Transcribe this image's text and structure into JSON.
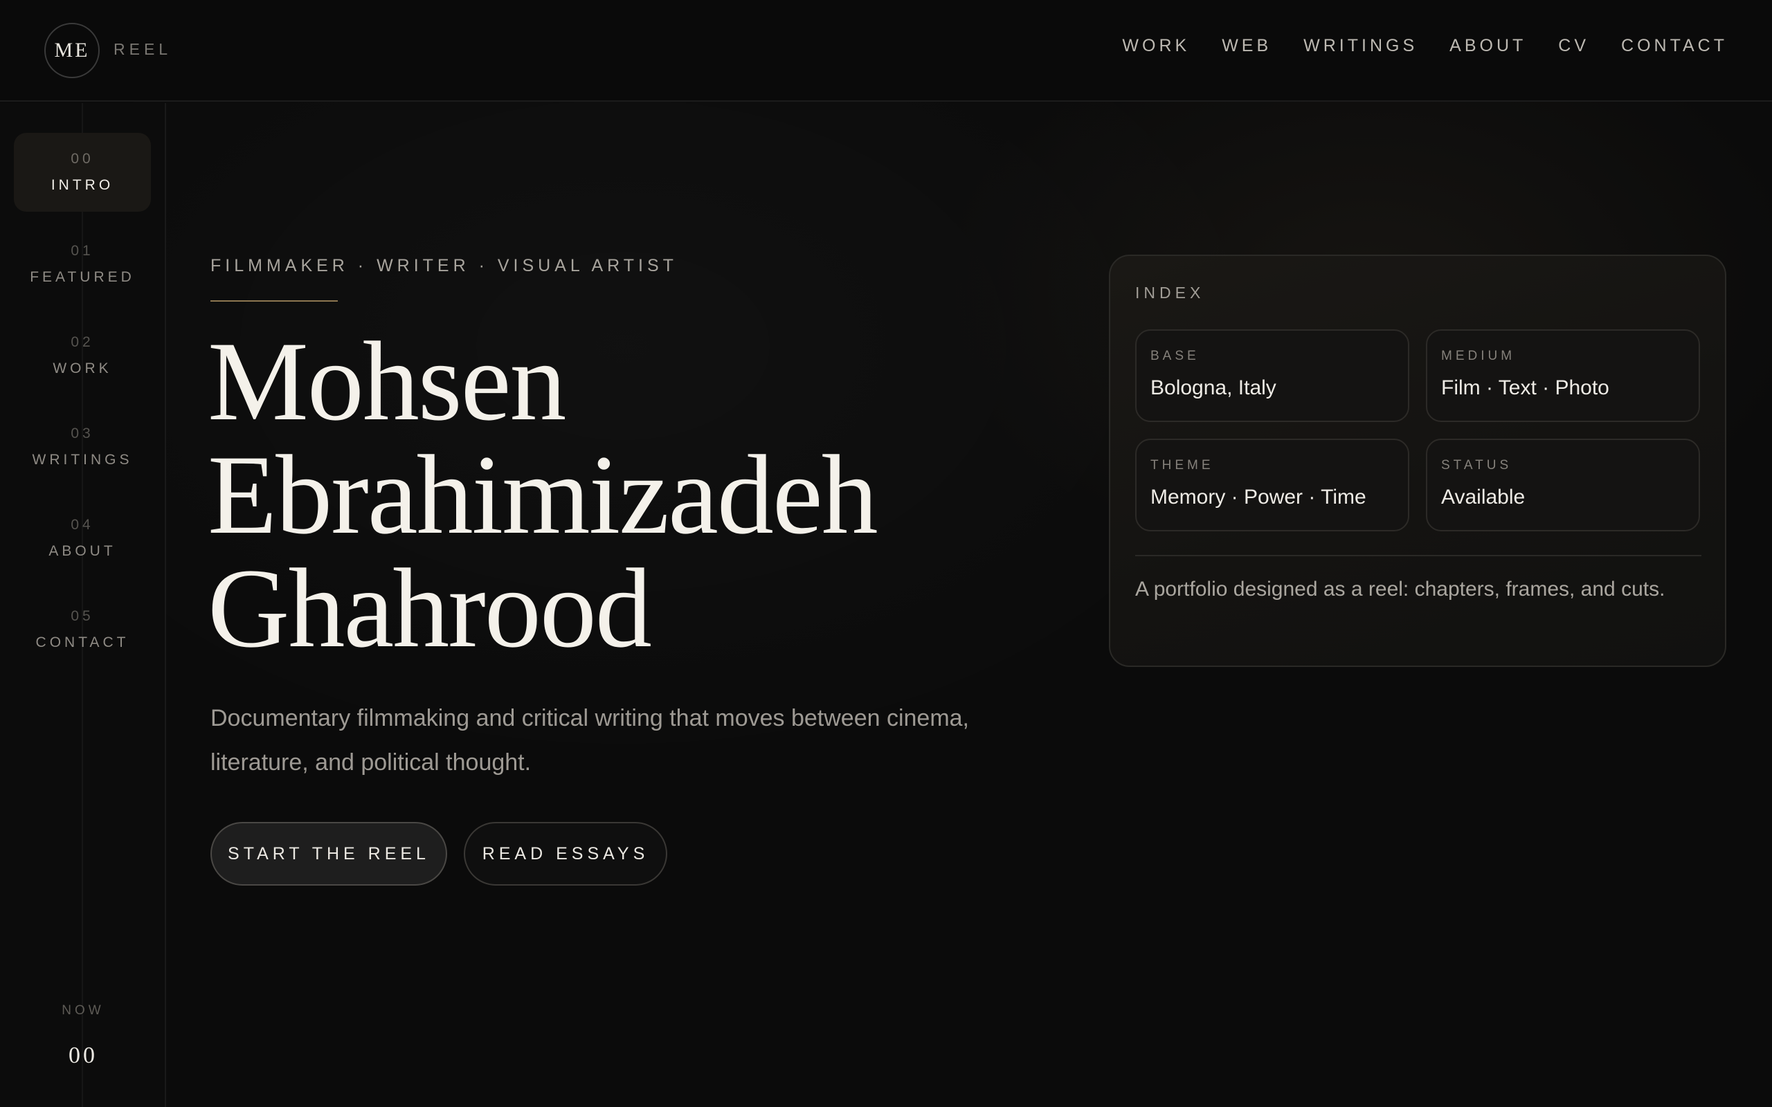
{
  "header": {
    "logo_mark": "ME",
    "logo_text": "REEL",
    "nav": [
      "WORK",
      "WEB",
      "WRITINGS",
      "ABOUT",
      "CV",
      "CONTACT"
    ]
  },
  "sidebar": {
    "items": [
      {
        "num": "00",
        "label": "INTRO",
        "active": true
      },
      {
        "num": "01",
        "label": "FEATURED",
        "active": false
      },
      {
        "num": "02",
        "label": "WORK",
        "active": false
      },
      {
        "num": "03",
        "label": "WRITINGS",
        "active": false
      },
      {
        "num": "04",
        "label": "ABOUT",
        "active": false
      },
      {
        "num": "05",
        "label": "CONTACT",
        "active": false
      }
    ],
    "now_label": "NOW",
    "now_value": "00"
  },
  "hero": {
    "kicker": "FILMMAKER · WRITER · VISUAL ARTIST",
    "name_lines": [
      "Mohsen",
      "Ebrahimizadeh",
      "Ghahrood"
    ],
    "description": "Documentary filmmaking and critical writing that moves between cinema, literature, and political thought.",
    "primary_button": "START THE REEL",
    "secondary_button": "READ ESSAYS"
  },
  "index_card": {
    "title": "INDEX",
    "cells": [
      {
        "label": "BASE",
        "value": "Bologna, Italy"
      },
      {
        "label": "MEDIUM",
        "value": "Film · Text · Photo"
      },
      {
        "label": "THEME",
        "value": "Memory · Power · Time"
      },
      {
        "label": "STATUS",
        "value": "Available"
      }
    ],
    "note": "A portfolio designed as a reel: chapters, frames, and cuts."
  },
  "colors": {
    "background": "#0b0b0b",
    "accent_rule": "#8c7650",
    "text_primary": "#f4f1ea",
    "text_muted": "#9e9a94"
  }
}
